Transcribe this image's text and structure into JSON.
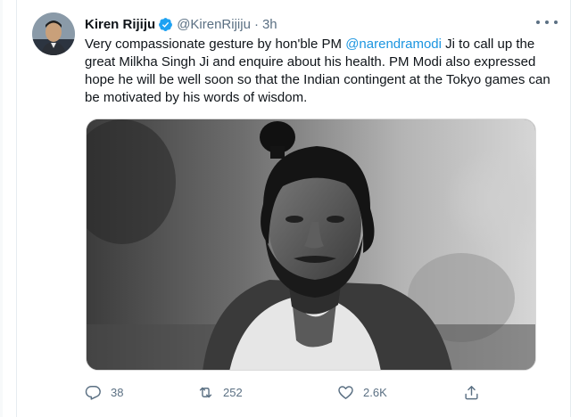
{
  "tweet": {
    "author_name": "Kiren Rijiju",
    "handle": "@KirenRijiju",
    "separator": "·",
    "time": "3h",
    "text_before": "Very compassionate gesture by hon'ble PM ",
    "mention": "@narendramodi",
    "text_after": " Ji to call up the great Milkha Singh Ji and enquire about his health. PM Modi also expressed hope he will be well soon so that the Indian contingent at the Tokyo games can be motivated by his words of wisdom."
  },
  "actions": {
    "reply_count": "38",
    "retweet_count": "252",
    "like_count": "2.6K"
  },
  "colors": {
    "accent": "#1da1f2",
    "mention": "#1b95e0",
    "secondary_text": "#5b7083"
  },
  "icons": [
    "verified-badge-icon",
    "more-options-icon",
    "reply-icon",
    "retweet-icon",
    "like-icon",
    "share-icon"
  ]
}
